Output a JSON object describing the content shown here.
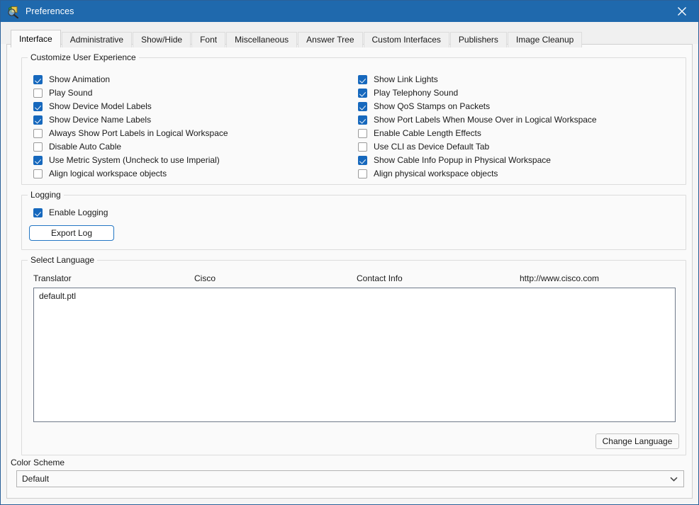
{
  "window": {
    "title": "Preferences",
    "icon": "preferences-magnifier-icon",
    "close_label": "×",
    "accent_color": "#1f69ad",
    "page_background": "#fafafa"
  },
  "tabs": [
    {
      "label": "Interface",
      "active": true
    },
    {
      "label": "Administrative",
      "active": false
    },
    {
      "label": "Show/Hide",
      "active": false
    },
    {
      "label": "Font",
      "active": false
    },
    {
      "label": "Miscellaneous",
      "active": false
    },
    {
      "label": "Answer Tree",
      "active": false
    },
    {
      "label": "Custom Interfaces",
      "active": false
    },
    {
      "label": "Publishers",
      "active": false
    },
    {
      "label": "Image Cleanup",
      "active": false
    }
  ],
  "customize_group": {
    "title": "Customize User Experience",
    "left_column": [
      {
        "label": "Show Animation",
        "checked": true
      },
      {
        "label": "Play Sound",
        "checked": false
      },
      {
        "label": "Show Device Model Labels",
        "checked": true
      },
      {
        "label": "Show Device Name Labels",
        "checked": true
      },
      {
        "label": "Always Show Port Labels in Logical Workspace",
        "checked": false
      },
      {
        "label": "Disable Auto Cable",
        "checked": false
      },
      {
        "label": "Use Metric System (Uncheck to use Imperial)",
        "checked": true
      },
      {
        "label": "Align logical workspace objects",
        "checked": false
      }
    ],
    "right_column": [
      {
        "label": "Show Link Lights",
        "checked": true
      },
      {
        "label": "Play Telephony Sound",
        "checked": true
      },
      {
        "label": "Show QoS Stamps on Packets",
        "checked": true
      },
      {
        "label": "Show Port Labels When Mouse Over in Logical Workspace",
        "checked": true
      },
      {
        "label": "Enable Cable Length Effects",
        "checked": false
      },
      {
        "label": "Use CLI as Device Default Tab",
        "checked": false
      },
      {
        "label": "Show Cable Info Popup in Physical Workspace",
        "checked": true
      },
      {
        "label": "Align physical workspace objects",
        "checked": false
      }
    ]
  },
  "logging_group": {
    "title": "Logging",
    "enable_logging": {
      "label": "Enable Logging",
      "checked": true
    },
    "export_log_button": "Export Log"
  },
  "language_group": {
    "title": "Select Language",
    "headers": [
      "Translator",
      "Cisco",
      "Contact Info",
      "http://www.cisco.com"
    ],
    "items": [
      "default.ptl"
    ],
    "change_language_button": "Change Language"
  },
  "color_scheme": {
    "label": "Color Scheme",
    "selected": "Default",
    "chevron": "chevron-down-icon"
  }
}
